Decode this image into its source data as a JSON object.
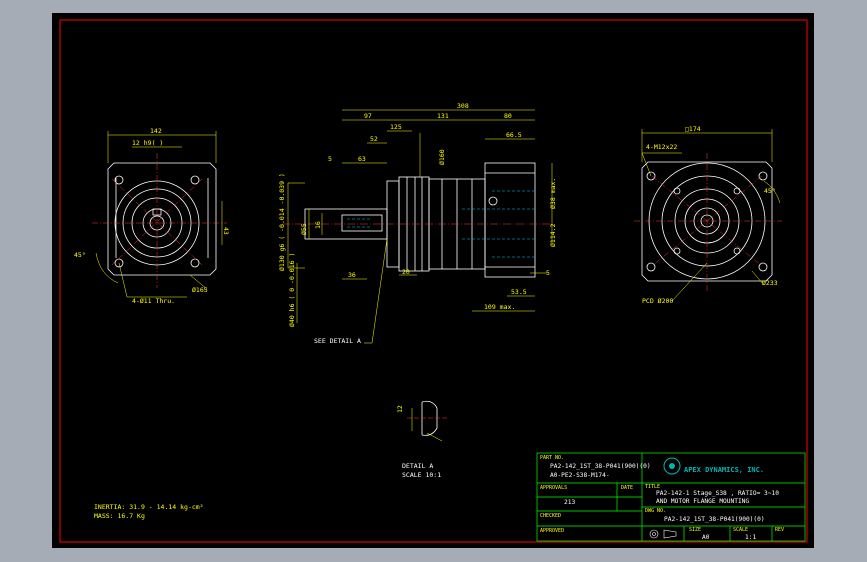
{
  "colors": {
    "background": "#000000",
    "frame": "#ff0000",
    "geometry": "#ffffff",
    "dimension": "#ffff00",
    "centerline": "#ff3333",
    "hidden": "#00c8ff",
    "title_block": "#00ff00",
    "logo": "#00b4b4"
  },
  "front_view": {
    "dims": {
      "width": "142",
      "key": "12 h9(  )",
      "height": "43",
      "angle": "45°",
      "circle": "Ø165",
      "holes": "4-Ø11 Thru."
    }
  },
  "side_view": {
    "dims": {
      "overall": "308",
      "d97": "97",
      "d131": "131",
      "d80": "80",
      "d125": "125",
      "d52": "52",
      "d665": "66.5",
      "d5a": "5",
      "d63": "63",
      "d160": "Ø160",
      "d38": "Ø38 max.",
      "d130": "Ø130 g6 ( -0.014 -0.039 )",
      "d55": "Ø55",
      "d16": "16",
      "d1142": "Ø114.2",
      "d36": "36",
      "d20": "20",
      "d5b": "5",
      "d535": "53.5",
      "d109": "109 max.",
      "d40": "Ø40 h6 ( 0 -0.016 )"
    },
    "see_detail": "SEE DETAIL A"
  },
  "rear_view": {
    "dims": {
      "square": "□174",
      "thread": "4-M12x22",
      "angle": "45°",
      "pcd": "PCD Ø200",
      "circle": "Ø233"
    }
  },
  "detail": {
    "dim": "12",
    "title": "DETAIL A",
    "scale": "SCALE 10:1"
  },
  "notes": {
    "inertia": "INERTIA: 31.9 - 14.14 kg-cm²",
    "mass": "MASS: 16.7  Kg"
  },
  "title_block": {
    "part_no_label": "PART NO.",
    "part_no_1": "PA2-142_1ST_38-P041(900)(0)",
    "part_no_2": "A0-PE2-S38-M174-",
    "company": "APEX DYNAMICS, INC.",
    "approved_label": "APPROVALS",
    "approved_value": "213",
    "date_label": "DATE",
    "checked_label": "CHECKED",
    "approved2_label": "APPROVED",
    "title_label": "TITLE",
    "title_1": "PA2-142-1 Stage_S38 , RATIO= 3~10",
    "title_2": "AND MOTOR FLANGE MOUNTING",
    "dwg_label": "DWG NO.",
    "dwg_value": "PA2-142_1ST_38-P041(900)(0)",
    "size_label": "SIZE",
    "size_value": "A0",
    "scale_label": "SCALE",
    "scale_value": "1:1",
    "rev_label": "REV"
  }
}
